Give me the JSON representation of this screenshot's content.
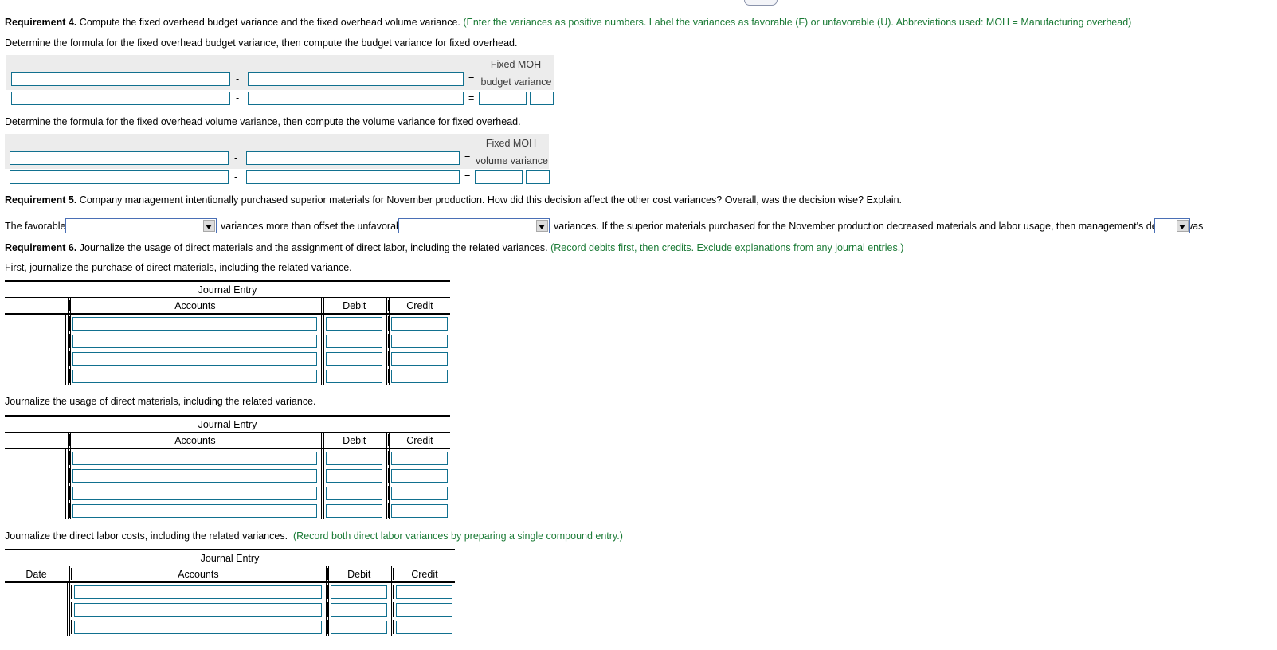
{
  "top_control": {
    "label": "···",
    "name": "more-options-pill"
  },
  "requirement4": {
    "label": "Requirement 4.",
    "text": " Compute the fixed overhead budget variance and the fixed overhead volume variance. ",
    "hint": "(Enter the variances as positive numbers. Label the variances as favorable (F) or unfavorable (U). Abbreviations used: MOH = Manufacturing overhead)",
    "instruction_budget": "Determine the formula for the fixed overhead budget variance, then compute the budget variance for fixed overhead.",
    "instruction_volume": "Determine the formula for the fixed overhead volume variance, then compute the volume variance for fixed overhead."
  },
  "budget_formula": {
    "minus_operator": "-",
    "equals_operator": "=",
    "moh_line1": "Fixed MOH",
    "moh_line2": "budget variance",
    "row1": {
      "left_value": "",
      "right_value": ""
    },
    "row2": {
      "left_value": "",
      "right_value": "",
      "result_value": "",
      "fu_value": ""
    }
  },
  "volume_formula": {
    "minus_operator": "-",
    "equals_operator": "=",
    "moh_line1": "Fixed MOH",
    "moh_line2": "volume variance",
    "row1": {
      "left_value": "",
      "right_value": ""
    },
    "row2": {
      "left_value": "",
      "right_value": "",
      "result_value": "",
      "fu_value": ""
    }
  },
  "requirement5": {
    "label": "Requirement 5.",
    "text": " Company management intentionally purchased superior materials for November production. How did this decision affect the other cost variances? Overall, was the decision wise? Explain.",
    "sentence_part1": "The favorable",
    "sentence_part2": "variances more than offset the unfavorable",
    "sentence_part3": "variances. If the superior materials purchased for the November production decreased materials and labor usage, then management's decision was",
    "dropdown1_value": "",
    "dropdown2_value": "",
    "dropdown3_value": ""
  },
  "requirement6": {
    "label": "Requirement 6.",
    "text": " Journalize the usage of direct materials and the assignment of direct labor, including the related variances. ",
    "hint": "(Record debits first, then credits. Exclude explanations from any journal entries.)",
    "sub1": "First, journalize the purchase of direct materials, including the related variance.",
    "sub2": "Journalize the usage of direct materials, including the related variance.",
    "sub3_text": "Journalize the direct labor costs, including the related variances.",
    "sub3_hint": "(Record both direct labor variances by preparing a single compound entry.)"
  },
  "journal_tables": [
    {
      "name": "purchase-of-direct-materials",
      "title": "Journal Entry",
      "columns": [
        "",
        "Accounts",
        "Debit",
        "Credit"
      ],
      "rows": [
        {
          "date": "",
          "accounts": "",
          "debit": "",
          "credit": ""
        },
        {
          "date": "",
          "accounts": "",
          "debit": "",
          "credit": ""
        },
        {
          "date": "",
          "accounts": "",
          "debit": "",
          "credit": ""
        },
        {
          "date": "",
          "accounts": "",
          "debit": "",
          "credit": ""
        }
      ]
    },
    {
      "name": "usage-of-direct-materials",
      "title": "Journal Entry",
      "columns": [
        "",
        "Accounts",
        "Debit",
        "Credit"
      ],
      "rows": [
        {
          "date": "",
          "accounts": "",
          "debit": "",
          "credit": ""
        },
        {
          "date": "",
          "accounts": "",
          "debit": "",
          "credit": ""
        },
        {
          "date": "",
          "accounts": "",
          "debit": "",
          "credit": ""
        },
        {
          "date": "",
          "accounts": "",
          "debit": "",
          "credit": ""
        }
      ]
    },
    {
      "name": "direct-labor-costs",
      "title": "Journal Entry",
      "columns": [
        "Date",
        "Accounts",
        "Debit",
        "Credit"
      ],
      "rows": [
        {
          "date": "",
          "accounts": "",
          "debit": "",
          "credit": ""
        },
        {
          "date": "",
          "accounts": "",
          "debit": "",
          "credit": ""
        },
        {
          "date": "",
          "accounts": "",
          "debit": "",
          "credit": ""
        }
      ]
    }
  ],
  "colors": {
    "input_border": "#11708f",
    "hint_green": "#1a7a35",
    "panel_gray": "#ececec",
    "dropdown_border": "#4a6fb5"
  }
}
